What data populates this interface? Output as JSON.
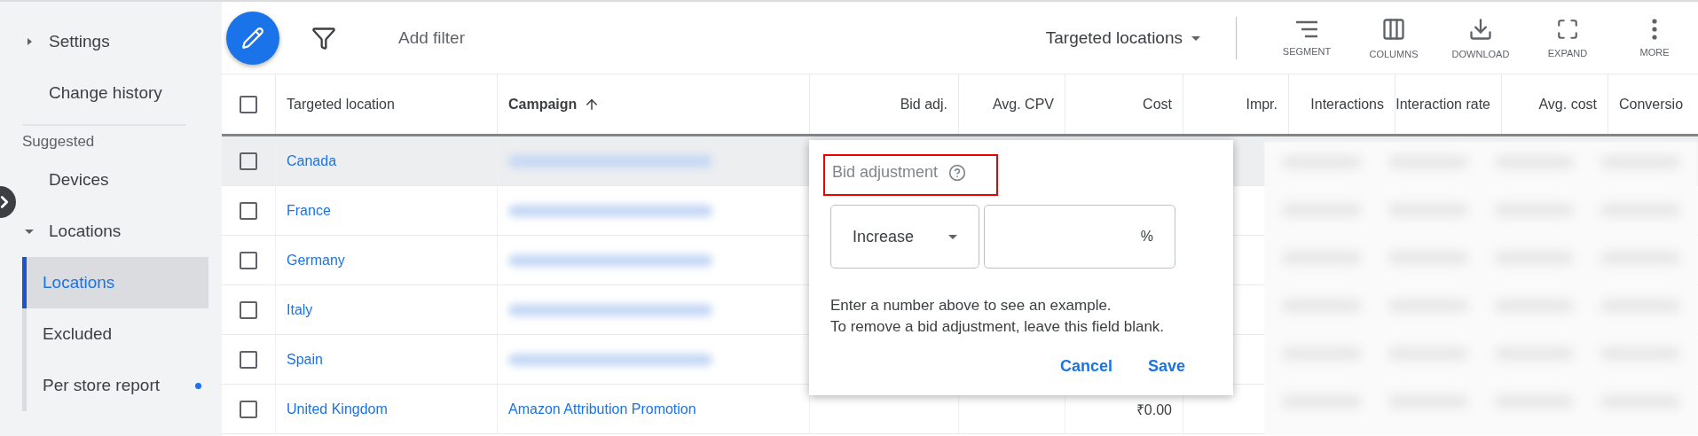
{
  "sidebar": {
    "items": [
      {
        "kind": "collapsible",
        "label": "Settings",
        "expanded": false
      },
      {
        "kind": "link",
        "label": "Change history"
      },
      {
        "kind": "section",
        "label": "Suggested"
      },
      {
        "kind": "link",
        "label": "Devices"
      },
      {
        "kind": "collapsible",
        "label": "Locations",
        "expanded": true,
        "children": [
          {
            "label": "Locations",
            "selected": true,
            "badge": false
          },
          {
            "label": "Excluded",
            "selected": false,
            "badge": false
          },
          {
            "label": "Per store report",
            "selected": false,
            "badge": true
          }
        ]
      }
    ]
  },
  "toolbar": {
    "filter_placeholder": "Add filter",
    "view": "Targeted locations",
    "actions": [
      {
        "kind": "segment",
        "label": "SEGMENT"
      },
      {
        "kind": "columns",
        "label": "COLUMNS"
      },
      {
        "kind": "download",
        "label": "DOWNLOAD"
      },
      {
        "kind": "expand",
        "label": "EXPAND"
      },
      {
        "kind": "more",
        "label": "MORE"
      }
    ]
  },
  "table": {
    "select_all": {
      "checked": false
    },
    "columns": [
      {
        "label": "Targeted location",
        "sorted": false
      },
      {
        "label": "Campaign",
        "sorted": true
      },
      {
        "label": "Bid adj.",
        "sorted": false
      },
      {
        "label": "Avg. CPV",
        "sorted": false
      },
      {
        "label": "Cost",
        "sorted": false
      },
      {
        "label": "Impr.",
        "sorted": false
      },
      {
        "label": "Interactions",
        "sorted": false
      },
      {
        "label": "Interaction rate",
        "sorted": false
      },
      {
        "label": "Avg. cost",
        "sorted": false
      },
      {
        "label": "Conversio",
        "sorted": false
      }
    ],
    "rows": [
      {
        "location": "Canada",
        "checked": false,
        "hovered": true,
        "campaign_redacted": true
      },
      {
        "location": "France",
        "checked": false,
        "hovered": false,
        "campaign_redacted": true
      },
      {
        "location": "Germany",
        "checked": false,
        "hovered": false,
        "campaign_redacted": true
      },
      {
        "location": "Italy",
        "checked": false,
        "hovered": false,
        "campaign_redacted": true
      },
      {
        "location": "Spain",
        "checked": false,
        "hovered": false,
        "campaign_redacted": true
      },
      {
        "location": "United Kingdom",
        "checked": false,
        "hovered": false,
        "campaign_redacted": false,
        "campaign": "Amazon Attribution Promotion",
        "cost": "₹0.00"
      }
    ]
  },
  "popup": {
    "title": "Bid adjustment",
    "highlighted": true,
    "mode": "Increase",
    "unit": "%",
    "help": "Enter a number above to see an example.\nTo remove a bid adjustment, leave this field blank.",
    "buttons": [
      {
        "label": "Cancel"
      },
      {
        "label": "Save"
      }
    ]
  }
}
